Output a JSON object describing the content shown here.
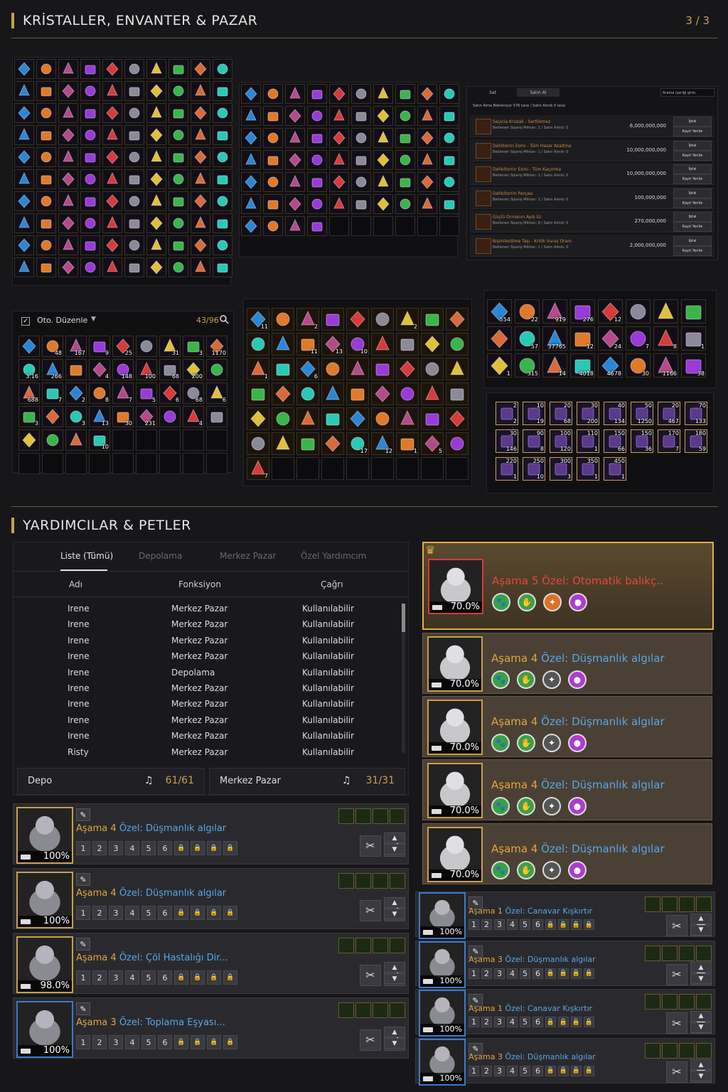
{
  "header": {
    "title": "KRİSTALLER, ENVANTER & PAZAR",
    "pager": "3 / 3"
  },
  "market": {
    "tabs": [
      "Sat",
      "Satın Al"
    ],
    "search_placeholder": "Arama içeriği girin.",
    "summary": "Satın Alma Bekleniyor  576 tane / Satın Alındı  0 tane",
    "cancel_label": "İptal",
    "renew_label": "Kayıt Yenile",
    "rows": [
      {
        "name": "Seçicia Kristali - Sertlikmez",
        "sub": "Beklenen Sipariş Miktarı: 2 / Satın Alındı: 0",
        "price": "6,000,000,000"
      },
      {
        "name": "Dehitorrin Esmi - Tüm Hasar Azaltma",
        "sub": "Beklenen Sipariş Miktarı: 1 / Satın Alındı: 0",
        "price": "10,000,000,000"
      },
      {
        "name": "Dehkitorrin Esmi - Tüm Kaçınma",
        "sub": "Beklenen Sipariş Miktarı: 1 / Satın Alındı: 0",
        "price": "10,000,000,000"
      },
      {
        "name": "Dehkitorrin Parçası",
        "sub": "Beklenen Sipariş Miktarı: 1 / Satın Alındı: 0",
        "price": "100,000,000"
      },
      {
        "name": "Güçlü Ormanın Aydı İzi",
        "sub": "Beklenen Sipariş Miktarı: 9 / Satın Alındı: 0",
        "price": "270,000,000"
      },
      {
        "name": "Bişmilerdime Taşı - Kritik Vuruş Oranı",
        "sub": "Beklenen Sipariş Miktarı: 1 / Satın Alındı: 0",
        "price": "2,000,000,000"
      }
    ]
  },
  "inventory": {
    "auto_sort": "Oto. Düzenle",
    "count": "43/96",
    "counts": [
      "",
      "48",
      "167",
      "9",
      "25",
      "",
      "31",
      "3",
      "1170",
      "3.16",
      "266",
      "",
      "4",
      "148",
      "100",
      "68",
      "200",
      "",
      "688",
      "7",
      "2",
      "8",
      "7",
      "5",
      "6",
      "68",
      "6",
      "3",
      "",
      "3",
      "13",
      "30",
      "231",
      "",
      "4",
      "",
      "",
      "",
      "",
      "10"
    ]
  },
  "boxes": {
    "counts": [
      "11",
      "",
      "2",
      "",
      "",
      "",
      "2",
      "",
      "",
      "",
      "",
      "11",
      "13",
      "10",
      "",
      "",
      "",
      "",
      "1",
      "",
      "6",
      "",
      "",
      "",
      "",
      "",
      "",
      "",
      "",
      "",
      "",
      "",
      "",
      "",
      "",
      "",
      "",
      "",
      "",
      "",
      "",
      "",
      "",
      "",
      "",
      "",
      "",
      "",
      "",
      "17",
      "12",
      "1",
      "5",
      "",
      "7"
    ]
  },
  "materials": {
    "counts": [
      "554",
      "22",
      "919",
      "276",
      "12",
      "",
      "",
      "",
      "",
      "57",
      "37765",
      "12",
      "24",
      "7",
      "8",
      "1",
      "1",
      "315",
      "14",
      "4018",
      "4678",
      "30",
      "1166",
      "38"
    ]
  },
  "seals": {
    "top": [
      "2",
      "10",
      "20",
      "30",
      "40",
      "50",
      "20",
      "70",
      "30",
      "90",
      "100",
      "110",
      "150",
      "150",
      "170",
      "180",
      "220",
      "250",
      "300",
      "350",
      "450"
    ],
    "bottom": [
      "2",
      "19",
      "68",
      "200",
      "134",
      "1250",
      "467",
      "133",
      "146",
      "8",
      "120",
      "1",
      "66",
      "36",
      "7",
      "59",
      "1",
      "10",
      "3",
      "1",
      "1"
    ]
  },
  "helpers": {
    "title": "YARDIMCILAR & PETLER",
    "tabs": [
      "Liste (Tümü)",
      "Depolama",
      "Merkez Pazar",
      "Özel Yardımcım"
    ],
    "columns": [
      "Adı",
      "Fonksiyon",
      "Çağrı"
    ],
    "rows": [
      {
        "name": "Irene",
        "func": "Merkez Pazar",
        "call": "Kullanılabilir"
      },
      {
        "name": "Irene",
        "func": "Merkez Pazar",
        "call": "Kullanılabilir"
      },
      {
        "name": "Irene",
        "func": "Merkez Pazar",
        "call": "Kullanılabilir"
      },
      {
        "name": "Irene",
        "func": "Merkez Pazar",
        "call": "Kullanılabilir"
      },
      {
        "name": "Irene",
        "func": "Depolama",
        "call": "Kullanılabilir"
      },
      {
        "name": "Irene",
        "func": "Merkez Pazar",
        "call": "Kullanılabilir"
      },
      {
        "name": "Irene",
        "func": "Merkez Pazar",
        "call": "Kullanılabilir"
      },
      {
        "name": "Irene",
        "func": "Merkez Pazar",
        "call": "Kullanılabilir"
      },
      {
        "name": "Irene",
        "func": "Merkez Pazar",
        "call": "Kullanılabilir"
      },
      {
        "name": "Risty",
        "func": "Merkez Pazar",
        "call": "Kullanılabilir"
      }
    ],
    "storage": {
      "label": "Depo",
      "value": "61/61"
    },
    "market": {
      "label": "Merkez Pazar",
      "value": "31/31"
    }
  },
  "pets_left": [
    {
      "stage": "Aşama 4",
      "skill": "Özel: Düşmanlık algılar",
      "pct": "100%",
      "border": "gold"
    },
    {
      "stage": "Aşama 4",
      "skill": "Özel: Düşmanlık algılar",
      "pct": "100%",
      "border": "gold"
    },
    {
      "stage": "Aşama 4",
      "skill": "Özel: Çöl Hastalığı Dir...",
      "pct": "98.0%",
      "border": "gold"
    },
    {
      "stage": "Aşama 3",
      "skill": "Özel: Toplama Eşyası...",
      "pct": "100%",
      "border": "blue"
    }
  ],
  "pet_slots": [
    "1",
    "2",
    "3",
    "4",
    "5",
    "6"
  ],
  "featured": [
    {
      "stage": "Aşama 5",
      "skill": "Özel: Otomatik balıkç..",
      "pct": "70.0%"
    },
    {
      "stage": "Aşama 4",
      "skill": "Özel: Düşmanlık algılar",
      "pct": "70.0%"
    },
    {
      "stage": "Aşama 4",
      "skill": "Özel: Düşmanlık algılar",
      "pct": "70.0%"
    },
    {
      "stage": "Aşama 4",
      "skill": "Özel: Düşmanlık algılar",
      "pct": "70.0%"
    },
    {
      "stage": "Aşama 4",
      "skill": "Özel: Düşmanlık algılar",
      "pct": "70.0%"
    }
  ],
  "pets_right": [
    {
      "stage": "Aşama 1",
      "skill": "Özel: Canavar Kışkırtır",
      "pct": "100%"
    },
    {
      "stage": "Aşama 3",
      "skill": "Özel: Düşmanlık algılar",
      "pct": "100%"
    },
    {
      "stage": "Aşama 1",
      "skill": "Özel: Canavar Kışkırtır",
      "pct": "100%"
    },
    {
      "stage": "Aşama 3",
      "skill": "Özel: Düşmanlık algılar",
      "pct": "100%"
    }
  ],
  "colors": {
    "accent": "#c9a04a",
    "blue": "#58a6e6",
    "red": "#e04a3a"
  }
}
